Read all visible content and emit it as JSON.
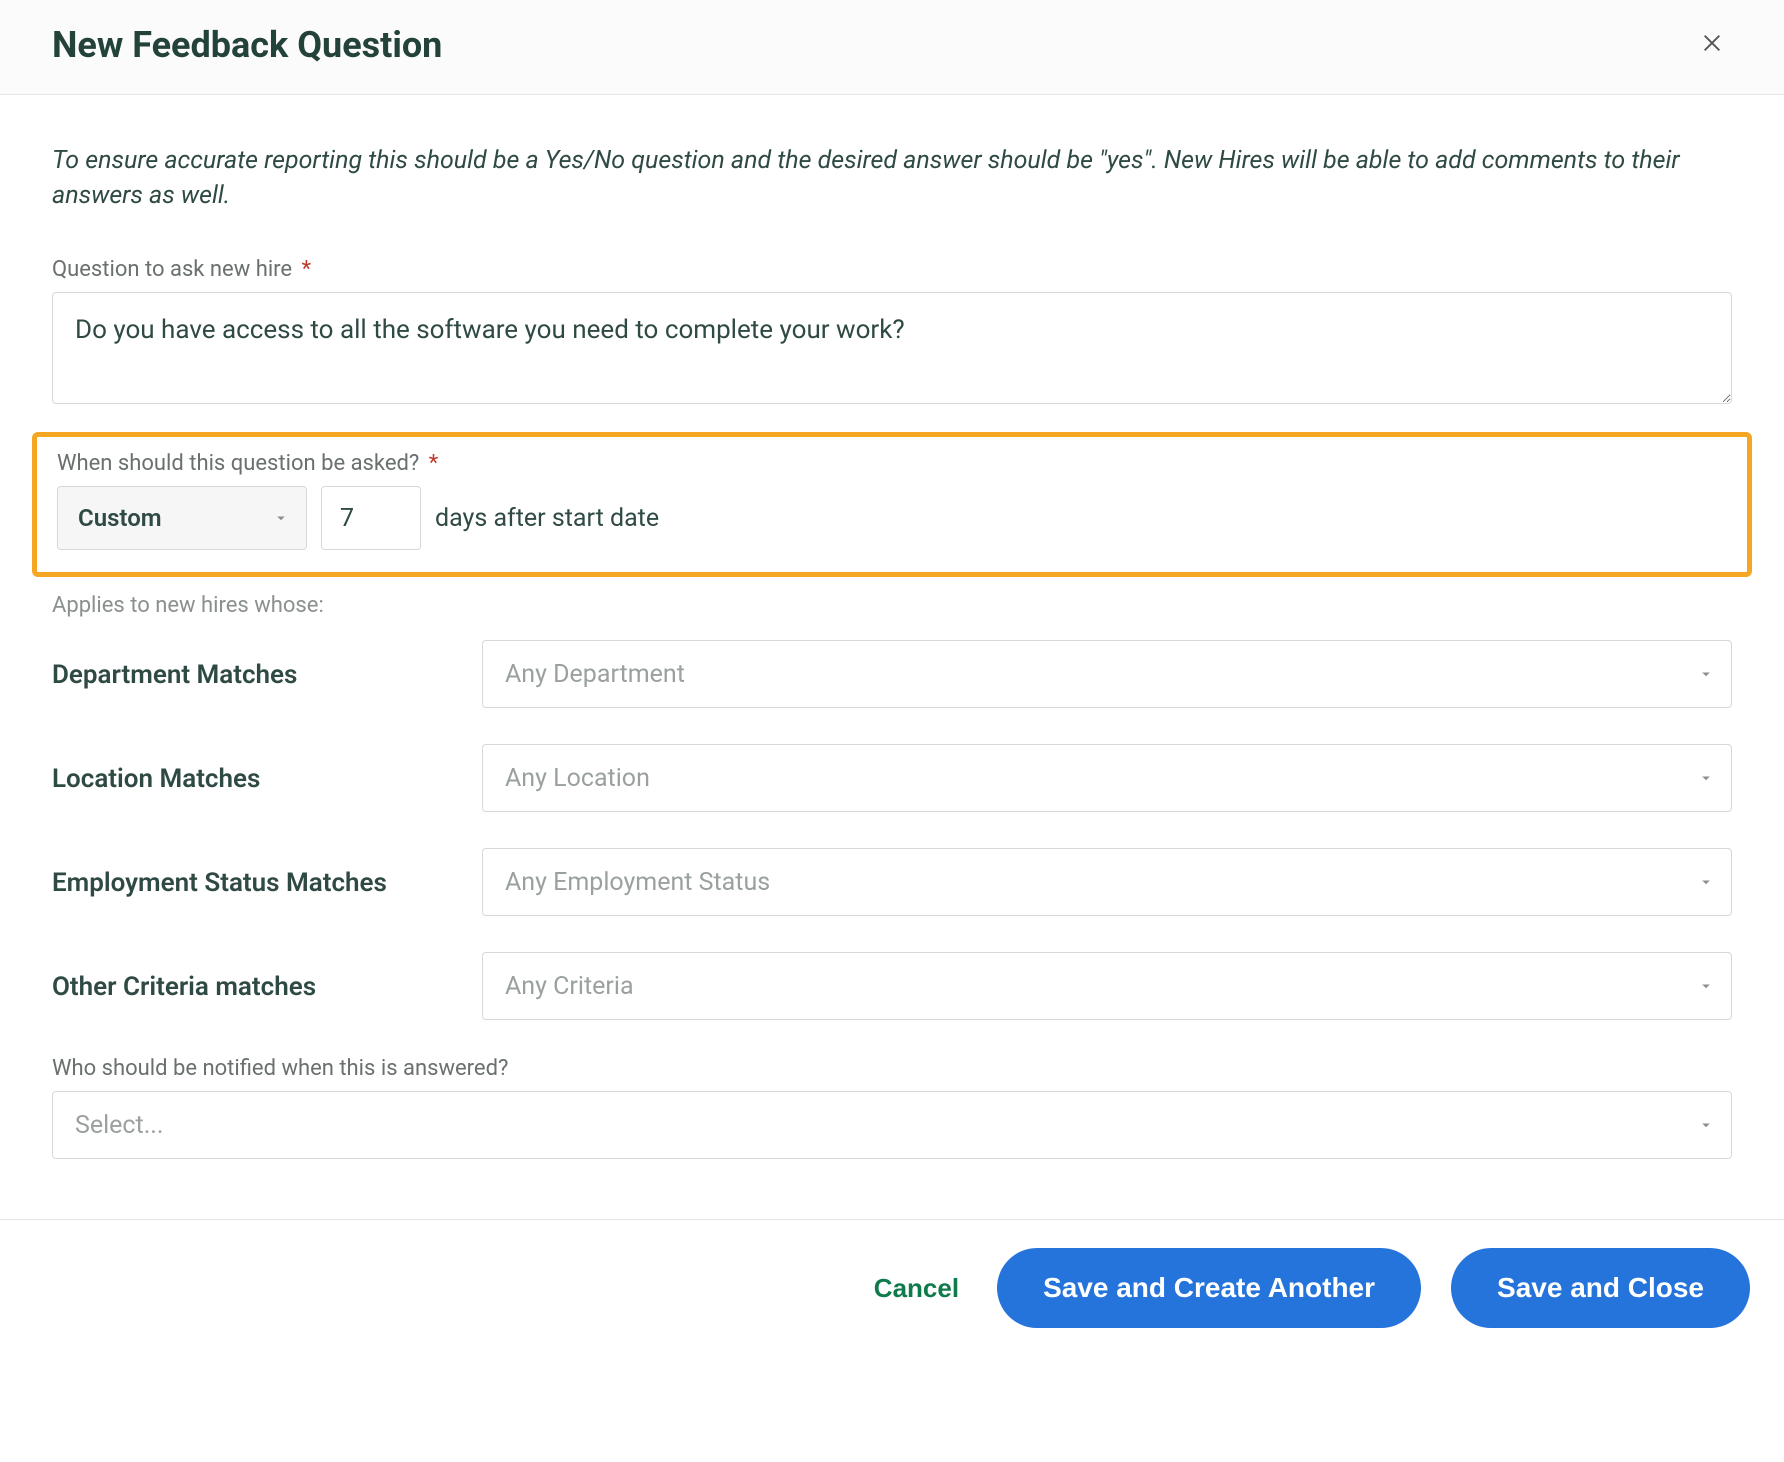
{
  "header": {
    "title": "New Feedback Question"
  },
  "help_text": "To ensure accurate reporting this should be a Yes/No question and the desired answer should be \"yes\". New Hires will be able to add comments to their answers as well.",
  "question": {
    "label": "Question to ask new hire",
    "value": "Do you have access to all the software you need to complete your work?"
  },
  "timing": {
    "label": "When should this question be asked?",
    "select_value": "Custom",
    "days_value": "7",
    "suffix": "days after start date"
  },
  "applies_label": "Applies to new hires whose:",
  "criteria": {
    "department": {
      "label": "Department Matches",
      "placeholder": "Any Department"
    },
    "location": {
      "label": "Location Matches",
      "placeholder": "Any Location"
    },
    "employment_status": {
      "label": "Employment Status Matches",
      "placeholder": "Any Employment Status"
    },
    "other": {
      "label": "Other Criteria matches",
      "placeholder": "Any Criteria"
    }
  },
  "notify": {
    "label": "Who should be notified when this is answered?",
    "placeholder": "Select..."
  },
  "footer": {
    "cancel": "Cancel",
    "save_another": "Save and Create Another",
    "save_close": "Save and Close"
  },
  "required_marker": "*"
}
